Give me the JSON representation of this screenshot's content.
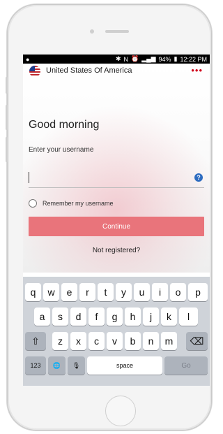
{
  "status_bar": {
    "left_icon": "notification-icon",
    "icons": [
      "bluetooth-icon",
      "nfc-icon",
      "alarm-icon",
      "wifi-icon",
      "signal-icon"
    ],
    "battery": "94%",
    "time": "12:22 PM"
  },
  "header": {
    "flag_icon": "us-flag-icon",
    "country": "United States Of America",
    "menu_icon": "more-dots-icon",
    "menu_glyph": "•••",
    "accent_color": "#d0021b"
  },
  "login": {
    "greeting": "Good morning",
    "username_label": "Enter your username",
    "username_value": "",
    "help_glyph": "?",
    "remember_label": "Remember my username",
    "continue_label": "Continue",
    "continue_color": "#e9747b",
    "not_registered": "Not registered?"
  },
  "keyboard": {
    "row1": [
      "q",
      "w",
      "e",
      "r",
      "t",
      "y",
      "u",
      "i",
      "o",
      "p"
    ],
    "row2": [
      "a",
      "s",
      "d",
      "f",
      "g",
      "h",
      "j",
      "k",
      "l"
    ],
    "row3": [
      "z",
      "x",
      "c",
      "v",
      "b",
      "n",
      "m"
    ],
    "shift_glyph": "⇧",
    "delete_glyph": "⌫",
    "numbers_label": "123",
    "globe_glyph": "🌐",
    "mic_glyph": "🎙",
    "space_label": "space",
    "go_label": "Go"
  }
}
